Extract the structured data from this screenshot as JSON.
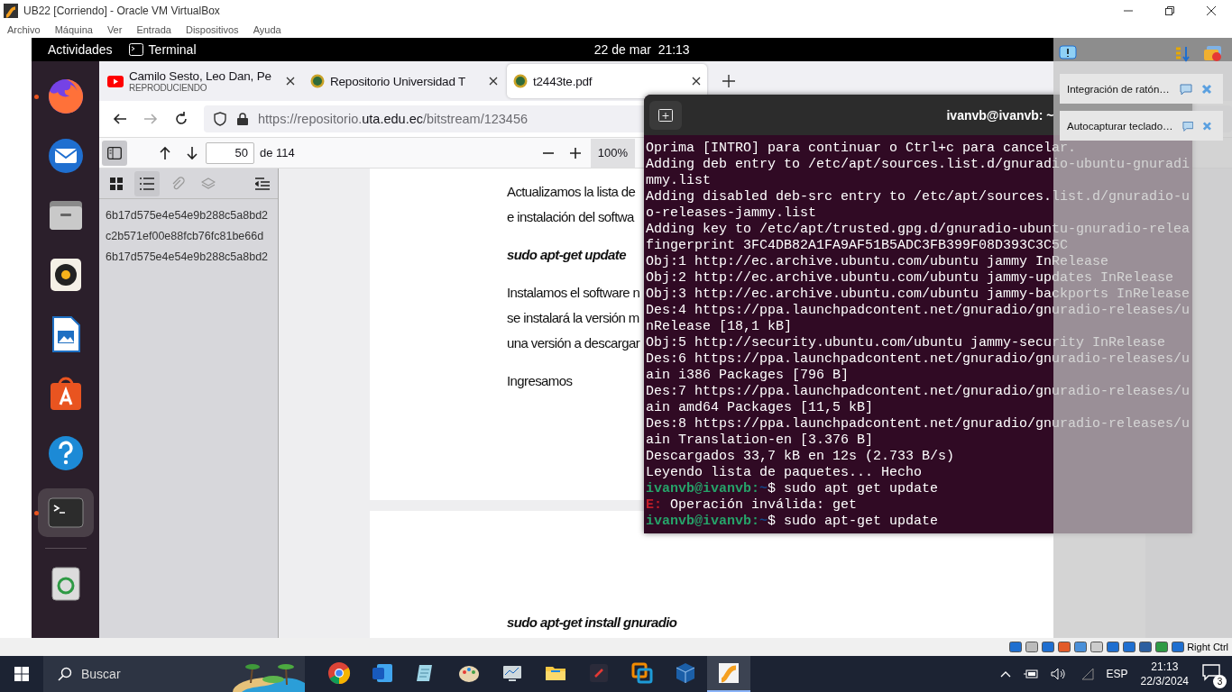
{
  "vbox": {
    "title": "UB22 [Corriendo] - Oracle VM VirtualBox",
    "menu": [
      "Archivo",
      "Máquina",
      "Ver",
      "Entrada",
      "Dispositivos",
      "Ayuda"
    ],
    "host_key": "Right Ctrl"
  },
  "topbar": {
    "activities": "Actividades",
    "app": "Terminal",
    "clock": "22 de mar  21:13"
  },
  "dock": [
    {
      "kind": "firefox",
      "running": true,
      "selected": false
    },
    {
      "kind": "mail",
      "running": false,
      "selected": false
    },
    {
      "kind": "files",
      "running": false,
      "selected": false
    },
    {
      "kind": "music",
      "running": false,
      "selected": false
    },
    {
      "kind": "writer",
      "running": false,
      "selected": false
    },
    {
      "kind": "store",
      "running": false,
      "selected": false
    },
    {
      "kind": "help",
      "running": false,
      "selected": false
    },
    {
      "kind": "terminal",
      "running": true,
      "selected": true
    },
    {
      "kind": "trash",
      "running": false,
      "selected": false
    }
  ],
  "browser": {
    "tabs": [
      {
        "kind": "media",
        "title": "Camilo Sesto, Leo Dan, Pe",
        "subtitle": "REPRODUCIENDO",
        "selected": false
      },
      {
        "kind": "site",
        "title": "Repositorio Universidad T",
        "selected": false
      },
      {
        "kind": "site",
        "title": "t2443te.pdf",
        "selected": true
      }
    ],
    "url": "https://repositorio.**uta.edu.ec**/bitstream/123456"
  },
  "pdf": {
    "page": "50",
    "page_count": "de 114",
    "zoom": "100%",
    "outline": [
      "6b17d575e4e54e9b288c5a8bd2",
      "c2b571ef00e88fcb76fc81be66d",
      "6b17d575e4e54e9b288c5a8bd2"
    ],
    "pages": [
      {
        "blocks": [
          {
            "kind": "text",
            "lines": [
              "Actualizamos la lista de",
              "e instalación del softwa"
            ]
          },
          {
            "kind": "command",
            "lines": [
              "sudo apt-get update"
            ]
          },
          {
            "kind": "text",
            "lines": [
              "Instalamos el software n",
              "se instalará la versión m",
              "una versión a descargar"
            ]
          },
          {
            "kind": "text",
            "lines": [
              "Ingresamos"
            ]
          }
        ]
      },
      {
        "blocks": [
          {
            "kind": "command",
            "lines": [
              "sudo apt-get install gnuradio"
            ]
          }
        ]
      }
    ]
  },
  "terminal": {
    "title": "ivanvb@ivanvb: ~",
    "lines": [
      {
        "kind": "out",
        "text": "Oprima [INTRO] para continuar o Ctrl+c para cancelar."
      },
      {
        "kind": "out",
        "text": "Adding deb entry to /etc/apt/sources.list.d/gnuradio-ubuntu-gnuradi"
      },
      {
        "kind": "out",
        "text": "mmy.list"
      },
      {
        "kind": "out",
        "text": "Adding disabled deb-src entry to /etc/apt/sources.list.d/gnuradio-u"
      },
      {
        "kind": "out",
        "text": "o-releases-jammy.list"
      },
      {
        "kind": "out",
        "text": "Adding key to /etc/apt/trusted.gpg.d/gnuradio-ubuntu-gnuradio-relea"
      },
      {
        "kind": "out",
        "text": "fingerprint 3FC4DB82A1FA9AF51B5ADC3FB399F08D393C3C5C"
      },
      {
        "kind": "out",
        "text": "Obj:1 http://ec.archive.ubuntu.com/ubuntu jammy InRelease"
      },
      {
        "kind": "out",
        "text": "Obj:2 http://ec.archive.ubuntu.com/ubuntu jammy-updates InRelease"
      },
      {
        "kind": "out",
        "text": "Obj:3 http://ec.archive.ubuntu.com/ubuntu jammy-backports InRelease"
      },
      {
        "kind": "out",
        "text": "Des:4 https://ppa.launchpadcontent.net/gnuradio/gnuradio-releases/u"
      },
      {
        "kind": "out",
        "text": "nRelease [18,1 kB]"
      },
      {
        "kind": "out",
        "text": "Obj:5 http://security.ubuntu.com/ubuntu jammy-security InRelease"
      },
      {
        "kind": "out",
        "text": "Des:6 https://ppa.launchpadcontent.net/gnuradio/gnuradio-releases/u"
      },
      {
        "kind": "out",
        "text": "ain i386 Packages [796 B]"
      },
      {
        "kind": "out",
        "text": "Des:7 https://ppa.launchpadcontent.net/gnuradio/gnuradio-releases/u"
      },
      {
        "kind": "out",
        "text": "ain amd64 Packages [11,5 kB]"
      },
      {
        "kind": "out",
        "text": "Des:8 https://ppa.launchpadcontent.net/gnuradio/gnuradio-releases/u"
      },
      {
        "kind": "out",
        "text": "ain Translation-en [3.376 B]"
      },
      {
        "kind": "out",
        "text": "Descargados 33,7 kB en 12s (2.733 B/s)"
      },
      {
        "kind": "out",
        "text": "Leyendo lista de paquetes... Hecho"
      },
      {
        "kind": "prompt",
        "user": "ivanvb@ivanvb:",
        "path": "~",
        "cmd": "$ sudo apt get update"
      },
      {
        "kind": "error",
        "label": "E:",
        "text": "Operación inválida: get"
      },
      {
        "kind": "prompt",
        "user": "ivanvb@ivanvb:",
        "path": "~",
        "cmd": "$ sudo apt-get update"
      }
    ]
  },
  "notifications": [
    {
      "text": "Integración de ratón…"
    },
    {
      "text": "Autocapturar teclado…"
    }
  ],
  "taskbar": {
    "search": {
      "placeholder": "Buscar"
    },
    "apps": [
      {
        "kind": "chrome",
        "selected": false
      },
      {
        "kind": "word",
        "selected": false
      },
      {
        "kind": "notes",
        "selected": false
      },
      {
        "kind": "paint",
        "selected": false
      },
      {
        "kind": "monitor",
        "selected": false
      },
      {
        "kind": "explorer",
        "selected": false
      },
      {
        "kind": "editor",
        "selected": false
      },
      {
        "kind": "vmware",
        "selected": false
      },
      {
        "kind": "virtualbox",
        "selected": false
      },
      {
        "kind": "vm",
        "selected": true
      }
    ],
    "language": "ESP",
    "time": "21:13",
    "date": "22/3/2024",
    "notification_count": "3"
  }
}
